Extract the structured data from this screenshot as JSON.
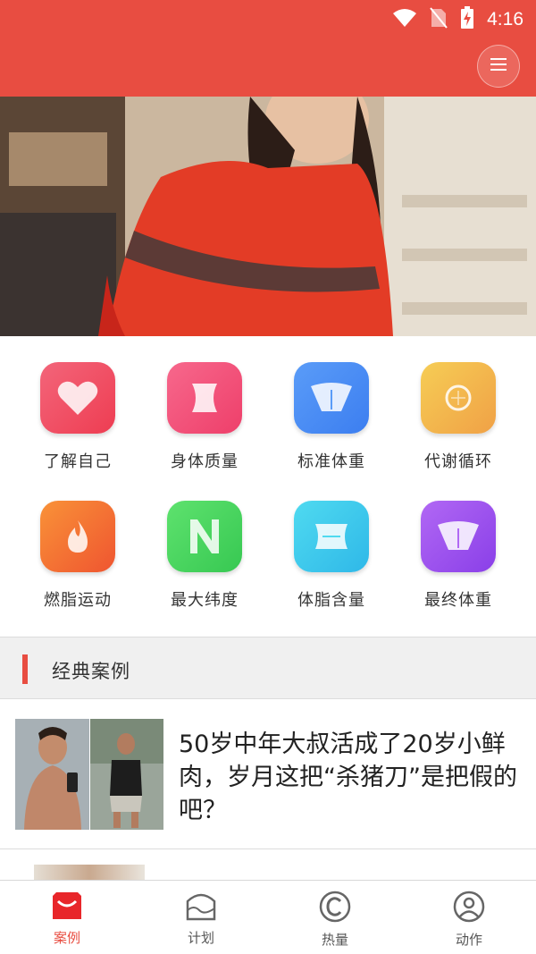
{
  "status_bar": {
    "time": "4:16",
    "icons": [
      "wifi-icon",
      "no-sim-icon",
      "battery-charging-icon"
    ]
  },
  "header": {
    "menu_icon": "menu-icon",
    "accent_color": "#e84d41"
  },
  "banner": {
    "page_count": 6,
    "active_page": 1
  },
  "features": [
    {
      "label": "了解自己",
      "icon": "heart-icon",
      "color_from": "#f3657a",
      "color_to": "#ee3d52"
    },
    {
      "label": "身体质量",
      "icon": "waist-icon",
      "color_from": "#f7688c",
      "color_to": "#ee3f6a"
    },
    {
      "label": "标准体重",
      "icon": "scale-icon",
      "color_from": "#5a9cf8",
      "color_to": "#3c7ef0"
    },
    {
      "label": "代谢循环",
      "icon": "cycle-icon",
      "color_from": "#f6cd55",
      "color_to": "#f0a146"
    },
    {
      "label": "燃脂运动",
      "icon": "flame-icon",
      "color_from": "#f99238",
      "color_to": "#ef5530"
    },
    {
      "label": "最大纬度",
      "icon": "letter-n-icon",
      "color_from": "#5ee26e",
      "color_to": "#37c852"
    },
    {
      "label": "体脂含量",
      "icon": "body-fat-icon",
      "color_from": "#4fdaf0",
      "color_to": "#2fb8e8"
    },
    {
      "label": "最终体重",
      "icon": "scale-icon",
      "color_from": "#b168f4",
      "color_to": "#8a3fe8"
    }
  ],
  "section": {
    "title": "经典案例"
  },
  "articles": [
    {
      "title": "50岁中年大叔活成了20岁小鲜肉，岁月这把“杀猪刀”是把假的吧？"
    }
  ],
  "bottom_nav": [
    {
      "label": "案例",
      "icon": "bag-icon",
      "active": true
    },
    {
      "label": "计划",
      "icon": "plan-icon",
      "active": false
    },
    {
      "label": "热量",
      "icon": "copyright-icon",
      "active": false
    },
    {
      "label": "动作",
      "icon": "user-icon",
      "active": false
    }
  ]
}
